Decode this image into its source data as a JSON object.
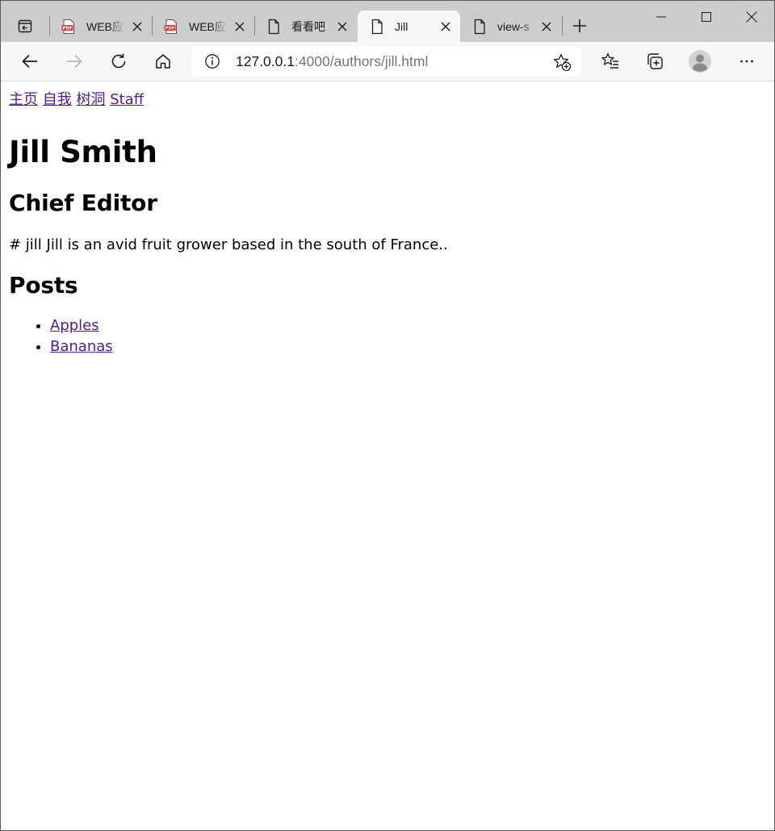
{
  "browser": {
    "tabs": [
      {
        "title": "WEB应用",
        "icon": "pdf-icon",
        "active": false
      },
      {
        "title": "WEB应用",
        "icon": "pdf-icon",
        "active": false
      },
      {
        "title": "看看吧",
        "icon": "page-icon",
        "active": false
      },
      {
        "title": "Jill",
        "icon": "page-icon",
        "active": true
      },
      {
        "title": "view-s",
        "icon": "page-icon",
        "active": false
      }
    ],
    "address": {
      "host": "127.0.0.1",
      "rest": ":4000/authors/jill.html"
    }
  },
  "page": {
    "nav": [
      "主页",
      "自我",
      "树洞",
      "Staff"
    ],
    "title": "Jill Smith",
    "position": "Chief Editor",
    "bio": "# jill Jill is an avid fruit grower based in the south of France..",
    "posts_heading": "Posts",
    "posts": [
      "Apples",
      "Bananas"
    ]
  },
  "colors": {
    "tabstrip": "#cdcdcd",
    "toolbar": "#f7f7f7",
    "visited_link": "#551a8b",
    "pdf_red": "#e0312f"
  }
}
